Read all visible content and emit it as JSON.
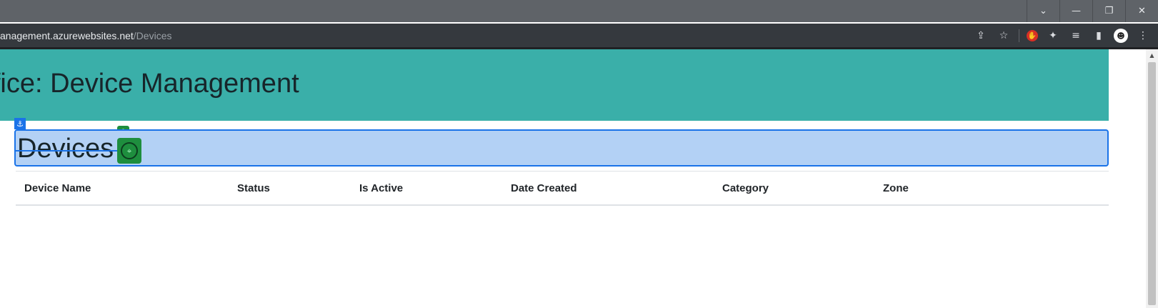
{
  "window": {
    "controls": [
      {
        "name": "tab-search",
        "glyph": "⌄"
      },
      {
        "name": "minimize",
        "glyph": "—"
      },
      {
        "name": "restore",
        "glyph": "❐"
      },
      {
        "name": "close",
        "glyph": "✕"
      }
    ]
  },
  "browser": {
    "url_host": "anagement.azurewebsites.net",
    "url_path": "/Devices",
    "icons": {
      "share": "⇪",
      "bookmark": "☆",
      "ext_red": "✋",
      "extensions": "✦",
      "media": "≡",
      "sidepanel": "▮",
      "profile": "☻",
      "menu": "⋮"
    }
  },
  "page": {
    "banner_title": "ffice: Device Management",
    "section_title": "Devices",
    "anchor_glyph": "⚓",
    "target_glyph": "⌖",
    "target_tab_glyph": "◎",
    "table": {
      "headers": [
        "Device Name",
        "Status",
        "Is Active",
        "Date Created",
        "Category",
        "Zone"
      ]
    }
  },
  "colors": {
    "banner": "#3aafa9",
    "selection": "#b3d1f5",
    "selection_border": "#1a73e8",
    "handle": "#1e8e3e"
  }
}
